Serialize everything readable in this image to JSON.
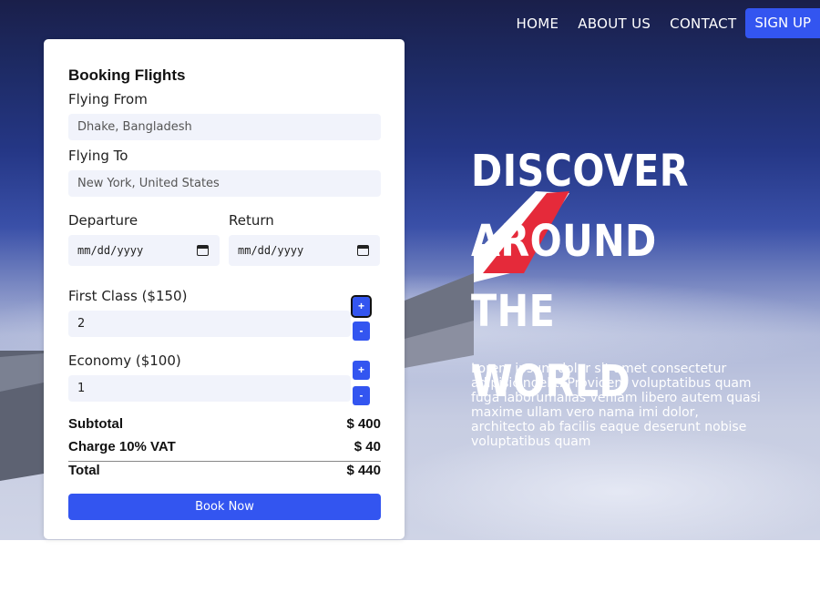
{
  "nav": {
    "links": [
      "HOME",
      "ABOUT US",
      "CONTACT"
    ],
    "signup": "SIGN UP"
  },
  "hero": {
    "headline": [
      "DISCOVER",
      "AROUND THE",
      "WORLD"
    ],
    "paragraph": "Lorem ipsum dolor sit amet consectetur adipisicingelit. Provident voluptatibus quam fuga laborumalias veniam libero autem quasi maxime ullam vero nama imi dolor, architecto ab facilis eaque deserunt nobise voluptatibus quam"
  },
  "booking": {
    "title": "Booking Flights",
    "from_label": "Flying From",
    "from_value": "Dhake, Bangladesh",
    "to_label": "Flying To",
    "to_value": "New York, United States",
    "departure_label": "Departure",
    "departure_value": "mm/dd/yyyy",
    "return_label": "Return",
    "return_value": "mm/dd/yyyy",
    "first_class_label": "First Class ($150)",
    "first_class_qty": "2",
    "economy_label": "Economy ($100)",
    "economy_qty": "1",
    "plus": "+",
    "minus": "-",
    "subtotal_label": "Subtotal",
    "subtotal_value": "$ 400",
    "vat_label": "Charge 10% VAT",
    "vat_value": "$ 40",
    "total_label": "Total",
    "total_value": "$ 440",
    "book_button": "Book Now"
  },
  "colors": {
    "accent": "#3355f0",
    "field_bg": "#f1f3fb"
  }
}
